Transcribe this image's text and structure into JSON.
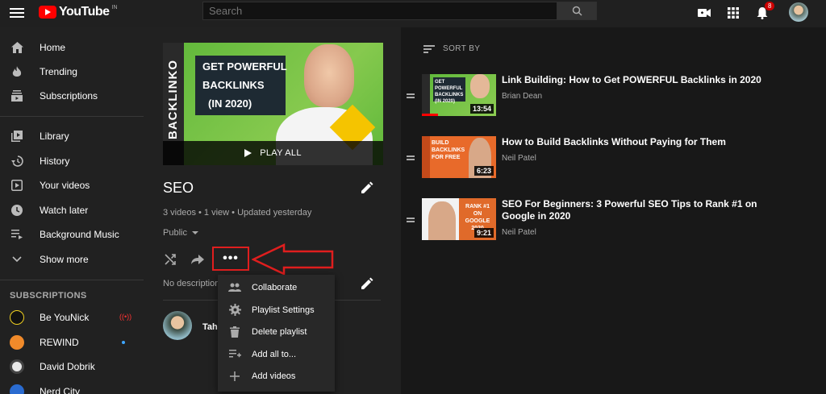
{
  "header": {
    "brand": "YouTube",
    "region": "IN",
    "search_placeholder": "Search",
    "notification_count": "8"
  },
  "sidebar": {
    "items": [
      {
        "label": "Home",
        "icon": "home-icon"
      },
      {
        "label": "Trending",
        "icon": "flame-icon"
      },
      {
        "label": "Subscriptions",
        "icon": "subscriptions-icon"
      },
      {
        "label": "Library",
        "icon": "library-icon"
      },
      {
        "label": "History",
        "icon": "history-icon"
      },
      {
        "label": "Your videos",
        "icon": "your-videos-icon"
      },
      {
        "label": "Watch later",
        "icon": "clock-icon"
      },
      {
        "label": "Background Music",
        "icon": "playlist-icon"
      },
      {
        "label": "Show more",
        "icon": "chevron-down-icon"
      }
    ],
    "subscriptions_heading": "SUBSCRIPTIONS",
    "subscriptions": [
      {
        "name": "Be YouNick",
        "badge": "live"
      },
      {
        "name": "REWIND",
        "badge": "new"
      },
      {
        "name": "David Dobrik",
        "badge": ""
      },
      {
        "name": "Nerd City",
        "badge": ""
      }
    ]
  },
  "playlist": {
    "thumb_side_text": "BACKLINKO",
    "thumb_lines": [
      "GET POWERFUL",
      "BACKLINKS",
      "(IN 2020)"
    ],
    "play_all": "PLAY ALL",
    "title": "SEO",
    "meta": "3 videos • 1 view • Updated yesterday",
    "privacy": "Public",
    "more_label": "•••",
    "description": "No description",
    "owner_name": "Taha"
  },
  "menu": {
    "items": [
      {
        "label": "Collaborate",
        "icon": "collaborate-icon"
      },
      {
        "label": "Playlist Settings",
        "icon": "gear-icon"
      },
      {
        "label": "Delete playlist",
        "icon": "trash-icon"
      },
      {
        "label": "Add all to...",
        "icon": "playlist-add-icon"
      },
      {
        "label": "Add videos",
        "icon": "plus-icon"
      }
    ]
  },
  "list": {
    "sort_label": "SORT BY",
    "videos": [
      {
        "title": "Link Building: How to Get POWERFUL Backlinks in 2020",
        "channel": "Brian Dean",
        "duration": "13:54",
        "thumb_text": "GET POWERFUL BACKLINKS (IN 2020)",
        "progress": 0.22
      },
      {
        "title": "How to Build Backlinks Without Paying for Them",
        "channel": "Neil Patel",
        "duration": "6:23",
        "thumb_text": "BUILD BACKLINKS FOR FREE",
        "progress": 0
      },
      {
        "title": "SEO For Beginners: 3 Powerful SEO Tips to Rank #1 on Google in 2020",
        "channel": "Neil Patel",
        "duration": "9:21",
        "thumb_text": "RANK #1 ON GOOGLE 2020",
        "progress": 0
      }
    ]
  },
  "colors": {
    "brand_red": "#ff0000",
    "annotation_red": "#e01e1e",
    "background": "#181818",
    "panel": "#212121"
  }
}
